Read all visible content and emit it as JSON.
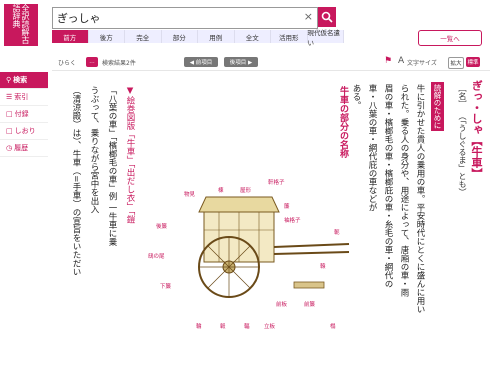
{
  "app": {
    "logo_text": "全訳読解古語辞典"
  },
  "search": {
    "value": "ぎっしゃ",
    "clear": "×",
    "icon": "search-icon"
  },
  "modes": [
    "前方",
    "後方",
    "完全",
    "部分",
    "用例",
    "全文",
    "活用形",
    "現代仮名遣い"
  ],
  "more_label": "一覧へ",
  "toolbar": {
    "open_label": "ひらく",
    "results_label": "検索結果2件",
    "prev_label": "◀ 前項目",
    "next_label": "後項目 ▶",
    "textsize_label": "文字サイズ",
    "zoom_in": "拡大",
    "zoom_std": "標準"
  },
  "sidebar": {
    "items": [
      {
        "label": "検索",
        "active": true
      },
      {
        "label": "索引",
        "active": false
      },
      {
        "label": "付録",
        "active": false
      },
      {
        "label": "しおり",
        "active": false
      },
      {
        "label": "履歴",
        "active": false
      }
    ]
  },
  "entry": {
    "headword": "ぎっ・しゃ【牛車】",
    "pos": "［名］",
    "reading_note": "（「うしぐるま」とも）",
    "guide_label": "読解のために",
    "body_lines": [
      "牛に引かせた貴人の乗用の車。平安時代にとくに盛んに用い",
      "られた。乗る人の身分や、用途によって、唐廂の車・雨",
      "眉の車・檳榔毛の車・檳榔庇の車・糸毛の車・網代の",
      "車・八葉の車・網代庇の車などが",
      "ある。"
    ],
    "diagram_title": "牛車の部分の名称",
    "sub_lines": [
      "▼絵巻図版「牛車」「出だし衣」「鎧",
      "「八葉の車」「檳榔毛の車」例 一牛車に乗",
      "うぶって、乗りながら宮中を出入",
      "（清涼殿）は）、牛車（=手車）の宣旨をいただい"
    ]
  },
  "diagram_labels": [
    "物見",
    "棟",
    "屋形",
    "軒格子",
    "簾",
    "袖格子",
    "前板",
    "軛",
    "轅",
    "轂",
    "輪",
    "輻",
    "鴟の尾",
    "前簾",
    "榻",
    "下簾",
    "後簾",
    "立板"
  ]
}
